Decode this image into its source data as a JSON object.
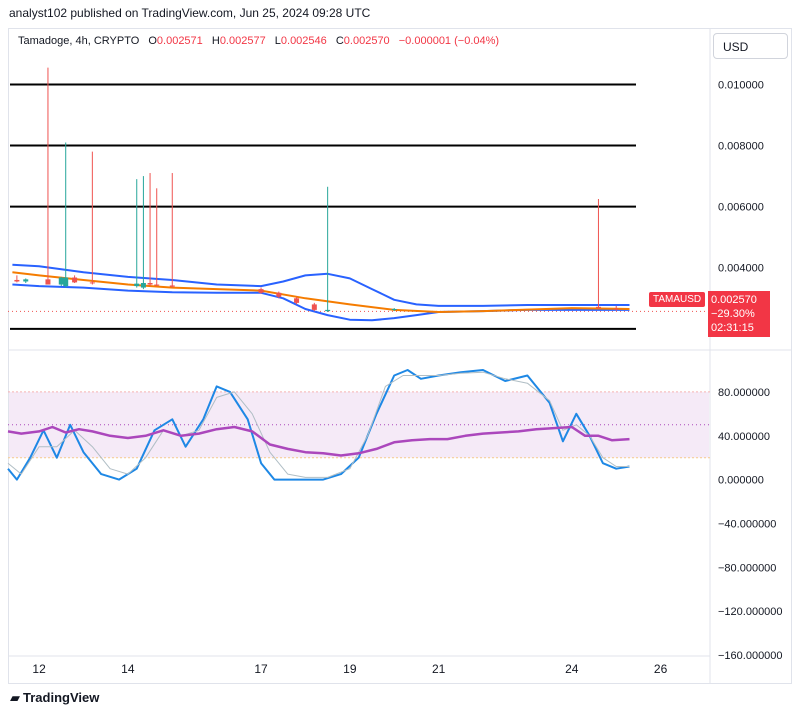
{
  "header": {
    "publisher_line": "analyst102 published on TradingView.com, Jun 25, 2024 09:28 UTC"
  },
  "legend": {
    "symbol": "Tamadoge, 4h, CRYPTO",
    "open_label": "O",
    "open": "0.002571",
    "high_label": "H",
    "high": "0.002577",
    "low_label": "L",
    "low": "0.002546",
    "close_label": "C",
    "close": "0.002570",
    "change": "−0.000001 (−0.04%)"
  },
  "currency": "USD",
  "ticker_tag": "TAMAUSD",
  "price_box": {
    "price": "0.002570",
    "change_pct": "−29.30%",
    "countdown": "02:31:15"
  },
  "footer": {
    "brand": "TradingView"
  },
  "colors": {
    "up": "#26a69a",
    "down": "#ef5350",
    "bb": "#2962ff",
    "ma": "#f57c00",
    "stoch_k": "#1e88e5",
    "rsi": "#ab47bc",
    "band_fill": "#f3e5f5"
  },
  "chart_data": [
    {
      "type": "line",
      "panel": "price",
      "y_ticks": [
        "0.010000",
        "0.008000",
        "0.006000",
        "0.004000"
      ],
      "ylim": [
        0.0017,
        0.0108
      ],
      "x_ticks": [
        "12",
        "14",
        "17",
        "19",
        "21",
        "24",
        "26"
      ],
      "x_tick_pos": [
        12,
        14,
        17,
        19,
        21,
        24,
        26
      ],
      "xlim": [
        11.3,
        27.0
      ],
      "horizontal_levels": [
        0.01,
        0.008,
        0.006,
        0.002
      ],
      "bollinger_upper": {
        "x": [
          11.4,
          12,
          13,
          14,
          15,
          16,
          17,
          17.5,
          18,
          18.5,
          19,
          19.5,
          20,
          20.5,
          21,
          22,
          23,
          24,
          25,
          25.3
        ],
        "y": [
          0.0041,
          0.00405,
          0.00385,
          0.0037,
          0.0036,
          0.00345,
          0.0034,
          0.00355,
          0.00375,
          0.0038,
          0.00365,
          0.0033,
          0.00295,
          0.0028,
          0.00275,
          0.00275,
          0.00278,
          0.00278,
          0.00278,
          0.00278
        ]
      },
      "bollinger_lower": {
        "x": [
          11.4,
          12,
          13,
          14,
          15,
          16,
          17,
          17.5,
          18,
          18.5,
          19,
          19.5,
          20,
          20.5,
          21,
          22,
          23,
          24,
          25,
          25.3
        ],
        "y": [
          0.00345,
          0.0034,
          0.00335,
          0.00325,
          0.0032,
          0.00318,
          0.00318,
          0.003,
          0.00265,
          0.00245,
          0.0023,
          0.00228,
          0.00235,
          0.00245,
          0.00255,
          0.00258,
          0.00262,
          0.00262,
          0.00262,
          0.00262
        ]
      },
      "moving_average": {
        "x": [
          11.4,
          12,
          13,
          14,
          15,
          16,
          17,
          18,
          19,
          20,
          21,
          22,
          23,
          24,
          25,
          25.3
        ],
        "y": [
          0.00385,
          0.00375,
          0.0036,
          0.00345,
          0.00335,
          0.0033,
          0.00325,
          0.003,
          0.0028,
          0.00262,
          0.00255,
          0.00258,
          0.00263,
          0.00268,
          0.00266,
          0.00265
        ]
      },
      "candles": [
        {
          "x": 11.5,
          "o": 0.0036,
          "h": 0.00375,
          "l": 0.00352,
          "c": 0.00355
        },
        {
          "x": 11.7,
          "o": 0.00355,
          "h": 0.00365,
          "l": 0.0035,
          "c": 0.00362
        },
        {
          "x": 12.2,
          "o": 0.00362,
          "h": 0.01055,
          "l": 0.00355,
          "c": 0.00345
        },
        {
          "x": 12.5,
          "o": 0.00345,
          "h": 0.0037,
          "l": 0.0034,
          "c": 0.00368
        },
        {
          "x": 12.6,
          "o": 0.0034,
          "h": 0.0081,
          "l": 0.00335,
          "c": 0.00368
        },
        {
          "x": 12.8,
          "o": 0.00368,
          "h": 0.00375,
          "l": 0.0035,
          "c": 0.00352
        },
        {
          "x": 13.2,
          "o": 0.00352,
          "h": 0.0078,
          "l": 0.00345,
          "c": 0.0035
        },
        {
          "x": 14.2,
          "o": 0.0034,
          "h": 0.0069,
          "l": 0.00335,
          "c": 0.00348
        },
        {
          "x": 14.35,
          "o": 0.00335,
          "h": 0.007,
          "l": 0.0033,
          "c": 0.0035
        },
        {
          "x": 14.5,
          "o": 0.0035,
          "h": 0.0071,
          "l": 0.0034,
          "c": 0.00345
        },
        {
          "x": 14.65,
          "o": 0.00345,
          "h": 0.0066,
          "l": 0.0034,
          "c": 0.00342
        },
        {
          "x": 15.0,
          "o": 0.00342,
          "h": 0.0071,
          "l": 0.00335,
          "c": 0.00338
        },
        {
          "x": 17.0,
          "o": 0.0033,
          "h": 0.00335,
          "l": 0.00315,
          "c": 0.00318
        },
        {
          "x": 17.4,
          "o": 0.00318,
          "h": 0.00322,
          "l": 0.003,
          "c": 0.00305
        },
        {
          "x": 17.8,
          "o": 0.003,
          "h": 0.00305,
          "l": 0.0028,
          "c": 0.00285
        },
        {
          "x": 18.2,
          "o": 0.0028,
          "h": 0.00285,
          "l": 0.00258,
          "c": 0.00262
        },
        {
          "x": 18.5,
          "o": 0.00258,
          "h": 0.00665,
          "l": 0.00255,
          "c": 0.00262
        },
        {
          "x": 20.0,
          "o": 0.00262,
          "h": 0.00268,
          "l": 0.00258,
          "c": 0.00265
        },
        {
          "x": 24.6,
          "o": 0.00272,
          "h": 0.00625,
          "l": 0.00265,
          "c": 0.00268
        },
        {
          "x": 25.0,
          "o": 0.00266,
          "h": 0.00275,
          "l": 0.0026,
          "c": 0.00265
        }
      ]
    },
    {
      "type": "line",
      "panel": "oscillator",
      "y_ticks": [
        "80.000000",
        "40.000000",
        "0.000000",
        "−40.000000",
        "−80.000000",
        "−120.000000",
        "−160.000000"
      ],
      "y_tick_values": [
        80,
        40,
        0,
        -40,
        -80,
        -120,
        -160
      ],
      "ylim": [
        -160,
        100
      ],
      "band": [
        20,
        80
      ],
      "series": [
        {
          "key": "stoch_k",
          "x": [
            11.3,
            11.5,
            11.8,
            12.1,
            12.4,
            12.7,
            13.0,
            13.4,
            13.8,
            14.2,
            14.6,
            15.0,
            15.3,
            15.7,
            16.0,
            16.3,
            16.7,
            17.0,
            17.3,
            17.6,
            18.0,
            18.4,
            18.8,
            19.2,
            19.6,
            20.0,
            20.3,
            20.6,
            21.0,
            21.5,
            22.0,
            22.5,
            23.0,
            23.5,
            23.8,
            24.1,
            24.4,
            24.7,
            25.0,
            25.3
          ],
          "y": [
            10,
            0,
            20,
            45,
            20,
            50,
            25,
            5,
            0,
            10,
            45,
            55,
            30,
            55,
            85,
            80,
            55,
            15,
            0,
            0,
            0,
            0,
            5,
            20,
            60,
            95,
            100,
            92,
            95,
            98,
            100,
            90,
            95,
            70,
            35,
            60,
            40,
            15,
            10,
            12
          ]
        },
        {
          "key": "stoch_d",
          "x": [
            11.3,
            11.6,
            12.0,
            12.4,
            12.8,
            13.2,
            13.6,
            14.0,
            14.4,
            14.8,
            15.2,
            15.6,
            16.0,
            16.4,
            16.8,
            17.2,
            17.6,
            18.0,
            18.5,
            19.0,
            19.4,
            19.8,
            20.2,
            20.6,
            21.0,
            21.5,
            22.0,
            22.5,
            23.0,
            23.5,
            23.8,
            24.1,
            24.4,
            24.7,
            25.0,
            25.3
          ],
          "y": [
            15,
            5,
            30,
            30,
            45,
            30,
            10,
            5,
            20,
            45,
            40,
            45,
            75,
            80,
            60,
            25,
            5,
            2,
            2,
            10,
            40,
            85,
            95,
            95,
            95,
            97,
            98,
            92,
            88,
            72,
            45,
            50,
            40,
            20,
            12,
            12
          ]
        },
        {
          "key": "rsi",
          "x": [
            11.3,
            11.6,
            12.0,
            12.3,
            12.6,
            12.9,
            13.2,
            13.6,
            14.0,
            14.4,
            14.8,
            15.2,
            15.6,
            16.0,
            16.4,
            16.8,
            17.2,
            17.6,
            18.0,
            18.4,
            18.8,
            19.2,
            19.6,
            20.0,
            20.4,
            20.8,
            21.2,
            21.6,
            22.0,
            22.4,
            22.8,
            23.2,
            23.6,
            24.0,
            24.3,
            24.6,
            24.9,
            25.3
          ],
          "y": [
            44,
            42,
            44,
            48,
            43,
            46,
            44,
            40,
            38,
            40,
            45,
            40,
            42,
            46,
            48,
            44,
            32,
            28,
            25,
            24,
            22,
            24,
            28,
            34,
            36,
            37,
            37,
            40,
            42,
            43,
            44,
            46,
            47,
            48,
            40,
            40,
            36,
            37
          ]
        }
      ]
    }
  ]
}
